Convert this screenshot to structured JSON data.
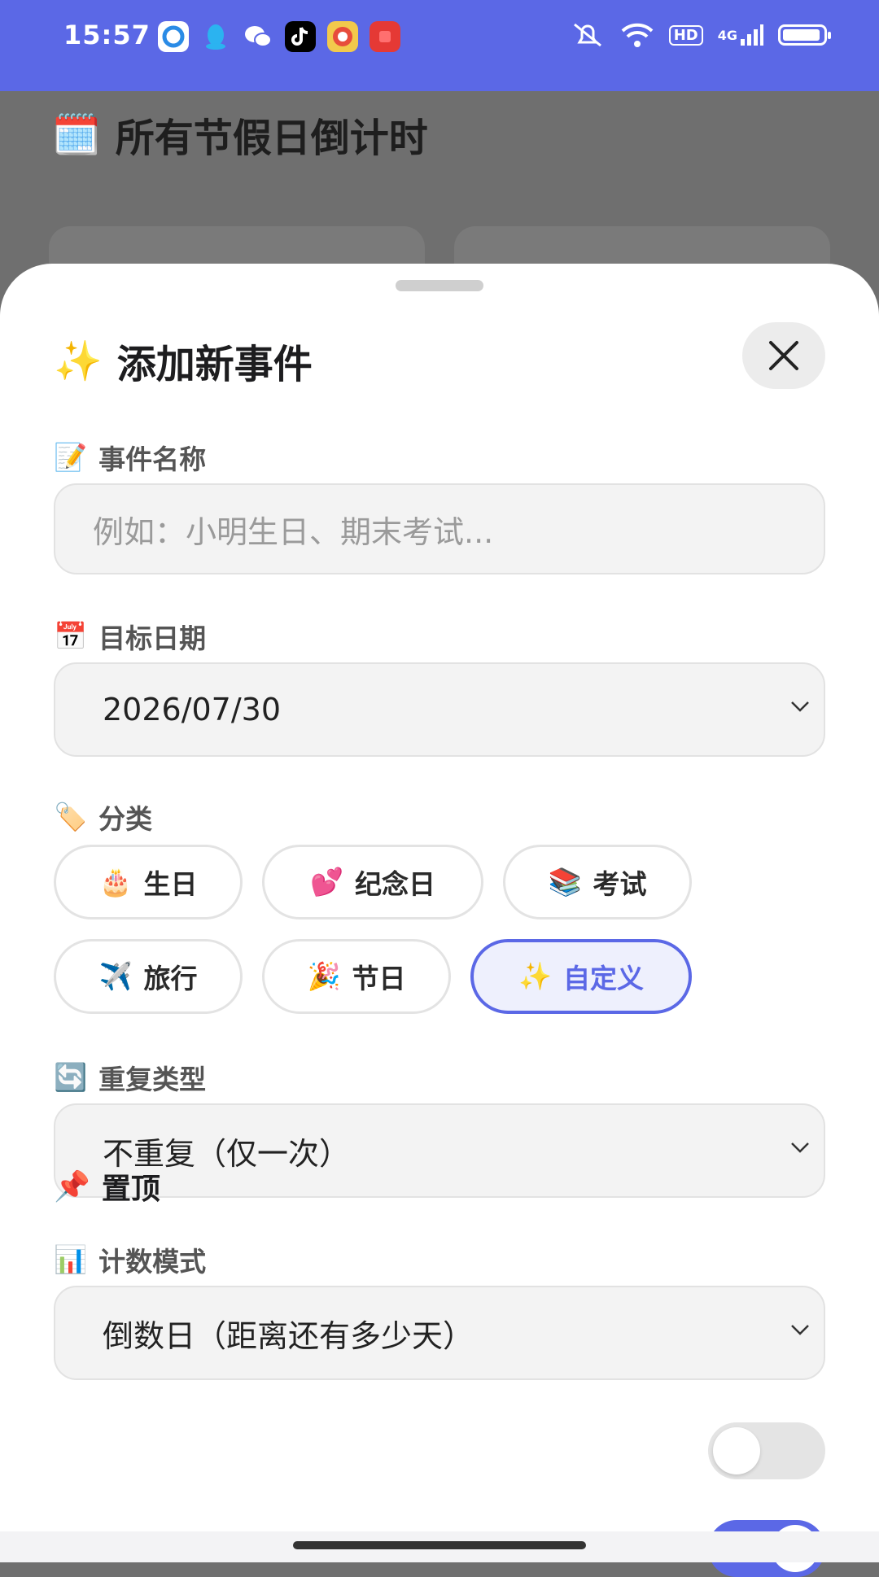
{
  "status_bar": {
    "time": "15:57",
    "apps": [
      "browser-app-icon",
      "qq-app-icon",
      "wechat-app-icon",
      "tiktok-app-icon",
      "game-app-icon",
      "red-app-icon"
    ],
    "hd": "HD",
    "network": "4G"
  },
  "background": {
    "title_icon": "🗓️",
    "title": "所有节假日倒计时"
  },
  "sheet": {
    "title_icon": "✨",
    "title": "添加新事件",
    "name_field": {
      "icon": "📝",
      "label": "事件名称",
      "placeholder": "例如：小明生日、期末考试..."
    },
    "date_field": {
      "icon": "📅",
      "label": "目标日期",
      "value": "2026/07/30"
    },
    "category": {
      "icon": "🏷️",
      "label": "分类",
      "options": [
        {
          "icon": "🎂",
          "label": "生日"
        },
        {
          "icon": "💕",
          "label": "纪念日"
        },
        {
          "icon": "📚",
          "label": "考试"
        },
        {
          "icon": "✈️",
          "label": "旅行"
        },
        {
          "icon": "🎉",
          "label": "节日"
        },
        {
          "icon": "✨",
          "label": "自定义"
        }
      ],
      "selected": "自定义"
    },
    "repeat_field": {
      "icon": "🔄",
      "label": "重复类型",
      "value": "不重复（仅一次）"
    },
    "count_field": {
      "icon": "📊",
      "label": "计数模式",
      "value": "倒数日（距离还有多少天）"
    },
    "pin": {
      "icon": "📌",
      "label": "置顶",
      "enabled": false
    }
  },
  "colors": {
    "accent": "#5b68e6",
    "field_bg": "#f3f3f3"
  }
}
